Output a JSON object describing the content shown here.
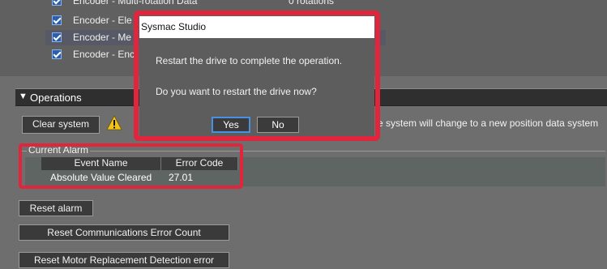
{
  "param_list": {
    "items": [
      {
        "label": "Encoder - Multi-rotation Data"
      },
      {
        "label": "Encoder - Ele"
      },
      {
        "label": "Encoder - Me"
      },
      {
        "label": "Encoder - Enc"
      }
    ],
    "top_right_text": "0 rotations"
  },
  "operations": {
    "title": "Operations",
    "clear_system_label": "Clear system",
    "warning_text": "e system will change to a new position data system"
  },
  "current_alarm": {
    "legend": "Current Alarm",
    "columns": [
      "Event Name",
      "Error Code"
    ],
    "rows": [
      {
        "event_name": "Absolute Value Cleared",
        "error_code": "27.01"
      }
    ]
  },
  "buttons": {
    "reset_alarm": "Reset alarm",
    "reset_comm": "Reset Communications Error Count",
    "reset_motor": "Reset Motor Replacement Detection error"
  },
  "dialog": {
    "title": "Sysmac Studio",
    "message1": "Restart the drive to complete the operation.",
    "message2": "Do you want to restart the drive now?",
    "yes_label": "Yes",
    "no_label": "No"
  },
  "colors": {
    "highlight": "#e0253d",
    "background": "#6e6e6e",
    "focus_blue": "#4a90e2"
  }
}
